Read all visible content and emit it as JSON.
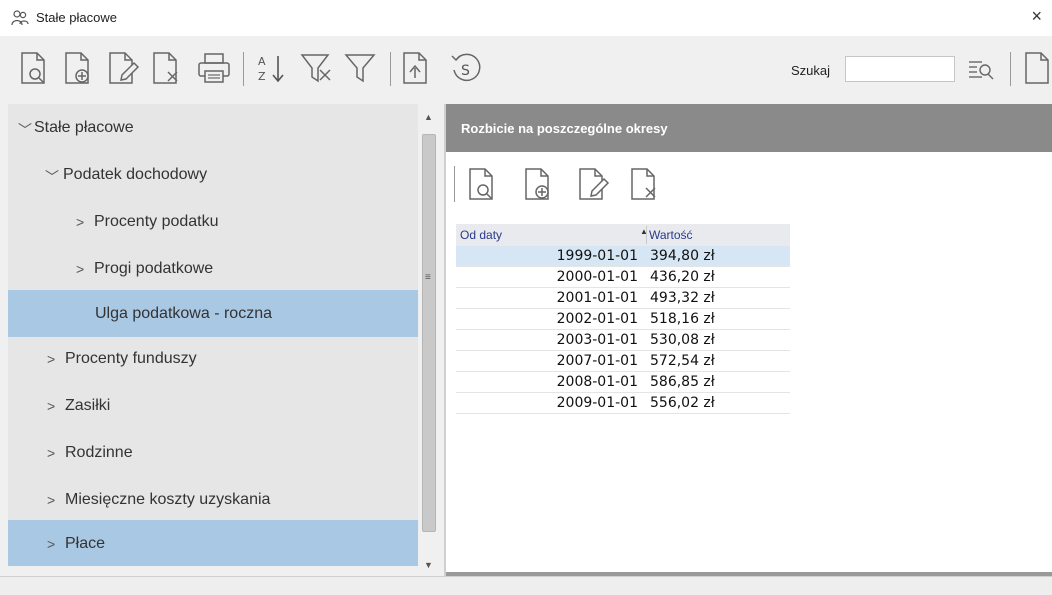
{
  "window": {
    "title": "Stałe płacowe",
    "close_glyph": "×",
    "icon": "people-group-icon"
  },
  "toolbar": {
    "icons": [
      "document-view-icon",
      "document-add-icon",
      "document-edit-icon",
      "document-delete-icon",
      "printer-icon",
      "sort-az-icon",
      "filter-clear-icon",
      "filter-icon",
      "export-icon",
      "currency-refresh-icon"
    ],
    "search_label": "Szukaj",
    "search_value": "",
    "search_button_icon": "search-list-icon",
    "more_icon": "document-icon"
  },
  "tree": {
    "items": [
      {
        "label": "Stałe płacowe",
        "chevron": "﹀",
        "level": 0
      },
      {
        "label": "Podatek dochodowy",
        "chevron": "﹀",
        "level": 1
      },
      {
        "label": "Procenty podatku",
        "chevron": ">",
        "level": 2
      },
      {
        "label": "Progi podatkowe",
        "chevron": ">",
        "level": 2
      },
      {
        "label": "Ulga podatkowa - roczna",
        "chevron": "",
        "level": 2,
        "selected": true
      },
      {
        "label": "Procenty funduszy",
        "chevron": ">",
        "level": 1
      },
      {
        "label": "Zasiłki",
        "chevron": ">",
        "level": 1
      },
      {
        "label": "Rodzinne",
        "chevron": ">",
        "level": 1
      },
      {
        "label": "Miesięczne koszty uzyskania",
        "chevron": ">",
        "level": 1
      },
      {
        "label": "Płace",
        "chevron": ">",
        "level": 1,
        "selected": true
      }
    ]
  },
  "panel": {
    "header": "Rozbicie na poszczególne okresy",
    "icons": [
      "document-view-icon",
      "document-add-icon",
      "document-edit-icon",
      "document-delete-icon"
    ]
  },
  "grid": {
    "columns": [
      "Od daty",
      "Wartość"
    ],
    "sort_indicator": "▲",
    "rows": [
      {
        "date": "1999-01-01",
        "value": "394,80 zł"
      },
      {
        "date": "2000-01-01",
        "value": "436,20 zł"
      },
      {
        "date": "2001-01-01",
        "value": "493,32 zł"
      },
      {
        "date": "2002-01-01",
        "value": "518,16 zł"
      },
      {
        "date": "2003-01-01",
        "value": "530,08 zł"
      },
      {
        "date": "2007-01-01",
        "value": "572,54 zł"
      },
      {
        "date": "2008-01-01",
        "value": "586,85 zł"
      },
      {
        "date": "2009-01-01",
        "value": "556,02 zł"
      }
    ]
  },
  "colors": {
    "selection": "#a9c8e4",
    "header": "#8a8a8a",
    "grid_selection": "#d7e6f4"
  }
}
